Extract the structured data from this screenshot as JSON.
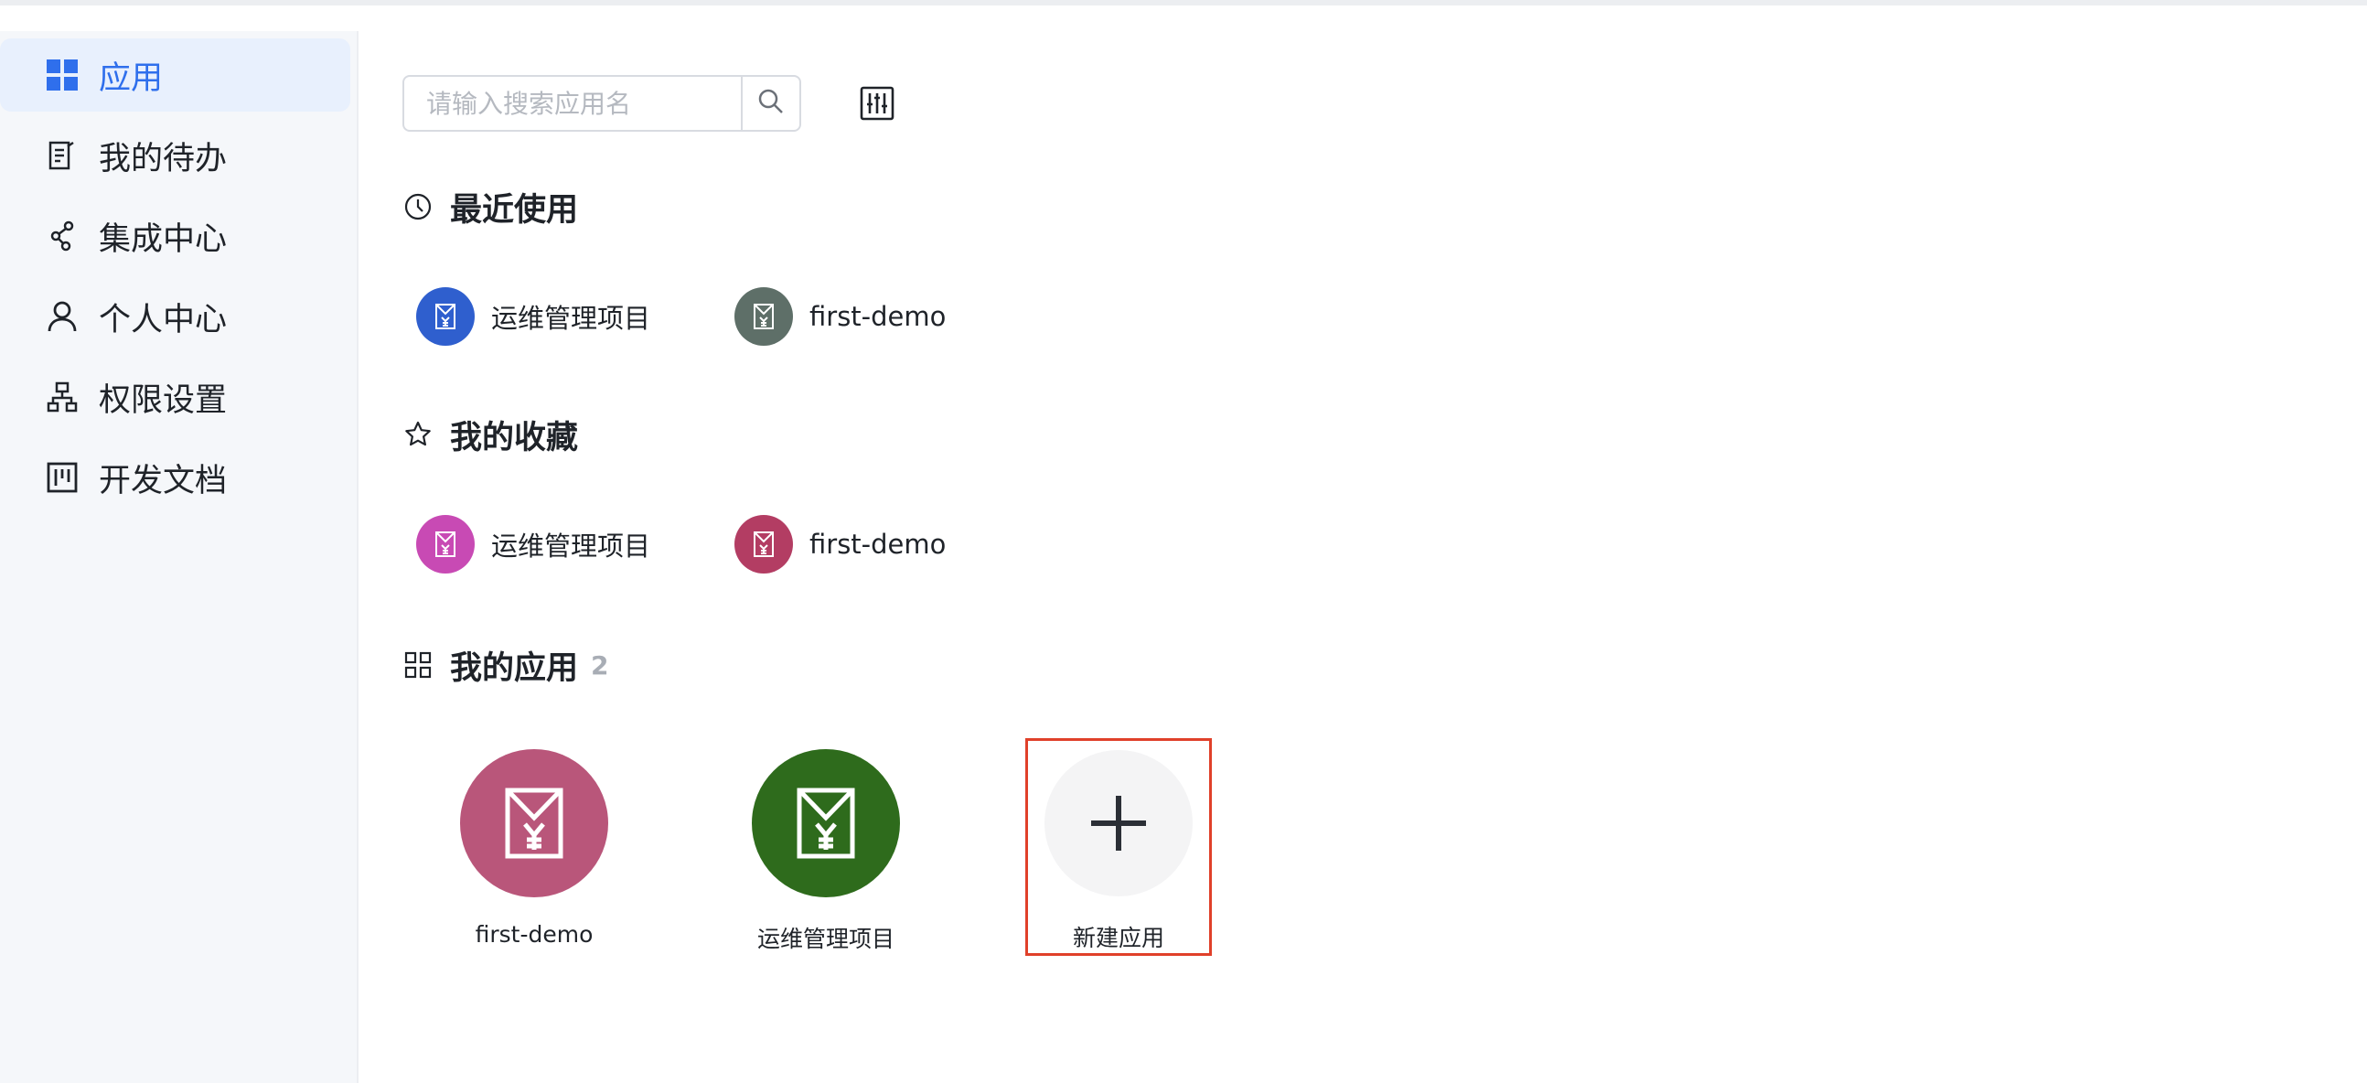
{
  "sidebar": {
    "items": [
      {
        "label": "应用",
        "icon": "grid-apps-icon",
        "active": true
      },
      {
        "label": "我的待办",
        "icon": "todo-list-icon",
        "active": false
      },
      {
        "label": "集成中心",
        "icon": "integration-icon",
        "active": false
      },
      {
        "label": "个人中心",
        "icon": "user-icon",
        "active": false
      },
      {
        "label": "权限设置",
        "icon": "org-chart-icon",
        "active": false
      },
      {
        "label": "开发文档",
        "icon": "kanban-doc-icon",
        "active": false
      }
    ]
  },
  "search": {
    "placeholder": "请输入搜索应用名",
    "value": ""
  },
  "sections": {
    "recent": {
      "title": "最近使用",
      "icon": "clock-icon"
    },
    "favorites": {
      "title": "我的收藏",
      "icon": "star-icon"
    },
    "my_apps": {
      "title": "我的应用",
      "count": "2",
      "icon": "apps-grid-icon"
    }
  },
  "recent_apps": [
    {
      "name": "运维管理项目",
      "color": "#2f5fce"
    },
    {
      "name": "first-demo",
      "color": "#5e6f68"
    }
  ],
  "favorite_apps": [
    {
      "name": "运维管理项目",
      "color": "#c84ab4"
    },
    {
      "name": "first-demo",
      "color": "#b33d63"
    }
  ],
  "my_apps": [
    {
      "name": "first-demo",
      "color": "#b9567a"
    },
    {
      "name": "运维管理项目",
      "color": "#2e6b1c"
    }
  ],
  "new_app": {
    "label": "新建应用"
  },
  "colors": {
    "accent": "#2f6fec",
    "highlight_border": "#e0402a"
  }
}
